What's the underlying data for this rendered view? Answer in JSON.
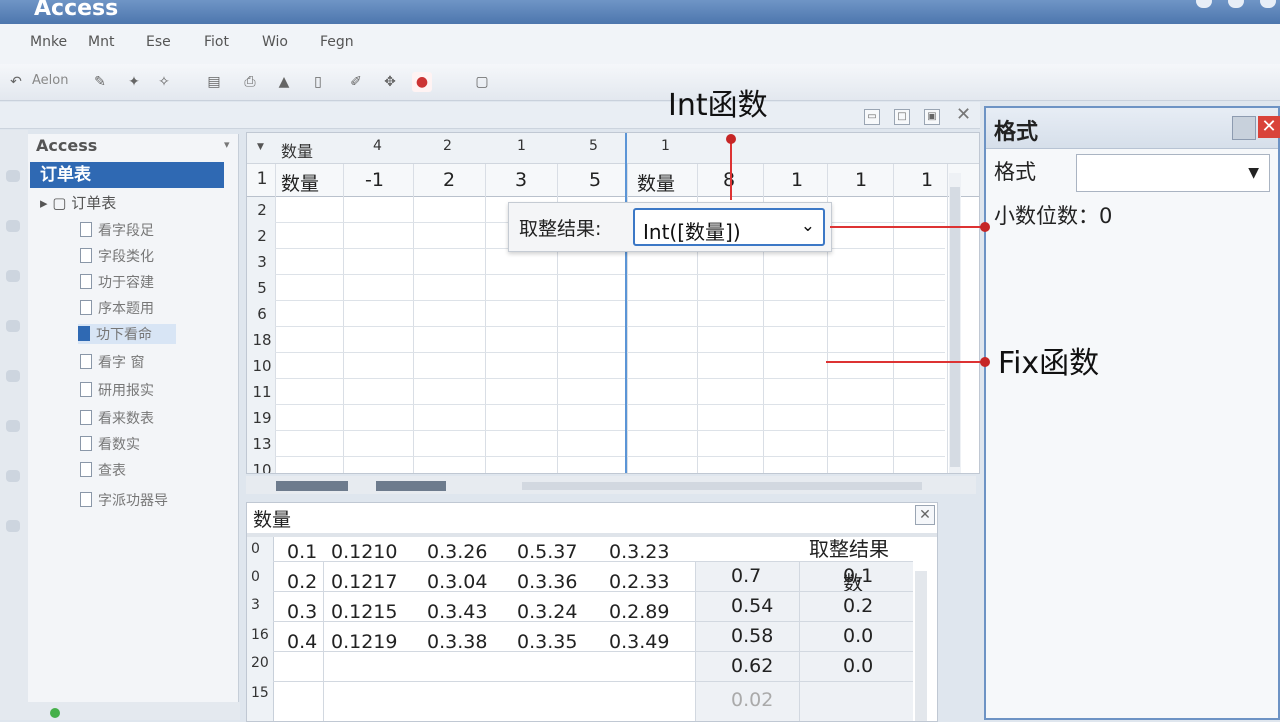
{
  "app": {
    "title": "Access"
  },
  "menu": [
    "Mnke",
    "Mnt",
    "Ese",
    "Fiot",
    "Wio",
    "Fegn"
  ],
  "toolbar": {
    "first_label": "Aelon"
  },
  "nav": {
    "header": "Access",
    "selected": "订单表",
    "root": "订单表",
    "items": [
      "看字段足",
      "字段类化",
      "功于容建",
      "序本题用",
      "功下看命",
      "看字  窗",
      "研用报实",
      "看来数表",
      "看数实",
      "查表",
      "字派功器导"
    ]
  },
  "grid": {
    "header_label": "数量",
    "header_values": [
      "4",
      "2",
      "1",
      "5",
      "1"
    ],
    "row1_label": "数量",
    "row1_values": [
      "-1",
      "2",
      "3",
      "5"
    ],
    "row1_label2": "数量",
    "row1_values2": [
      "8",
      "1",
      "1",
      "1"
    ],
    "row_numbers": [
      "2",
      "2",
      "3",
      "5",
      "6",
      "18",
      "10",
      "11",
      "19",
      "13",
      "10"
    ]
  },
  "popup": {
    "label": "取整结果:",
    "value": "Int([数量])"
  },
  "bottom": {
    "title": "数量",
    "result_header": "取整结果",
    "result_sub": "数",
    "line_numbers": [
      "0",
      "0",
      "3",
      "16",
      "20",
      "15"
    ],
    "rows": [
      [
        "0.1",
        "0.1210",
        "0.3.26",
        "0.5.37",
        "0.3.23",
        "0.7",
        "0.1"
      ],
      [
        "0.2",
        "0.1217",
        "0.3.04",
        "0.3.36",
        "0.2.33",
        "0.54",
        "0.2"
      ],
      [
        "0.3",
        "0.1215",
        "0.3.43",
        "0.3.24",
        "0.2.89",
        "0.58",
        "0.0"
      ],
      [
        "0.4",
        "0.1219",
        "0.3.38",
        "0.3.35",
        "0.3.49",
        "0.62",
        "0.0"
      ]
    ],
    "extra_value": "0.02"
  },
  "props": {
    "title": "格式",
    "format_label": "格式",
    "decimal_label": "小数位数：0"
  },
  "callouts": {
    "int": "Int函数",
    "fix": "Fix函数"
  },
  "colors": {
    "accent": "#2f69b3",
    "callout_red": "#c62626"
  }
}
